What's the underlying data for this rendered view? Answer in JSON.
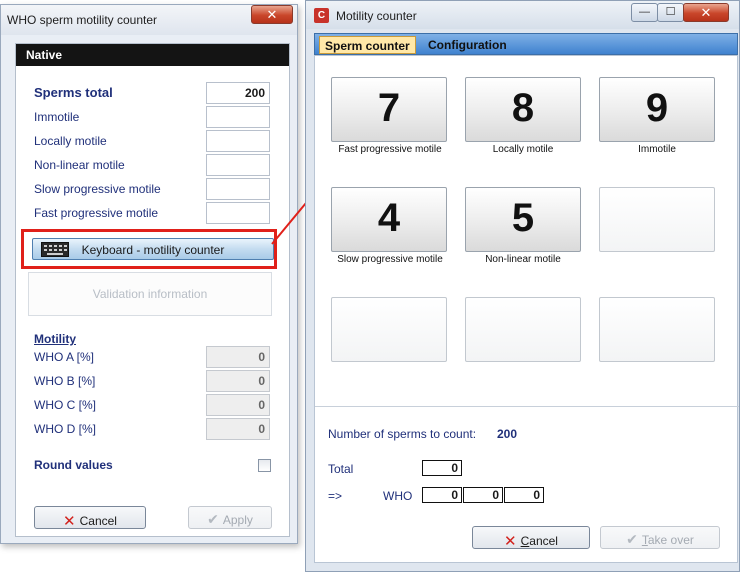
{
  "left_window": {
    "title": "WHO sperm motility counter",
    "close_glyph": "✕",
    "panel_title": "Native",
    "fields": [
      {
        "label": "Sperms total",
        "value": "200"
      },
      {
        "label": "Immotile",
        "value": ""
      },
      {
        "label": "Locally motile",
        "value": ""
      },
      {
        "label": "Non-linear motile",
        "value": ""
      },
      {
        "label": "Slow progressive motile",
        "value": ""
      },
      {
        "label": "Fast progressive motile",
        "value": ""
      }
    ],
    "keyboard_button_label": "Keyboard - motility counter",
    "keyboard_icon": "keyboard-icon",
    "validation_text": "Validation information",
    "motility_title": "Motility",
    "motility_fields": [
      {
        "label": "WHO A [%]",
        "value": "0"
      },
      {
        "label": "WHO B [%]",
        "value": "0"
      },
      {
        "label": "WHO C [%]",
        "value": "0"
      },
      {
        "label": "WHO D [%]",
        "value": "0"
      }
    ],
    "round_values_label": "Round values",
    "round_values_checked": false,
    "cancel_label": "Cancel",
    "apply_label": "Apply",
    "highlight_color": "#e0201a"
  },
  "right_window": {
    "title": "Motility counter",
    "app_icon_glyph": "C",
    "minimize_glyph": "—",
    "maximize_glyph": "☐",
    "close_glyph": "✕",
    "tabs": [
      {
        "label": "Sperm counter",
        "active": true
      },
      {
        "label": "Configuration",
        "active": false
      }
    ],
    "keys": [
      {
        "number": "7",
        "caption": "Fast progressive motile"
      },
      {
        "number": "8",
        "caption": "Locally motile"
      },
      {
        "number": "9",
        "caption": "Immotile"
      },
      {
        "number": "4",
        "caption": "Slow progressive motile"
      },
      {
        "number": "5",
        "caption": "Non-linear motile"
      },
      {
        "number": "",
        "caption": ""
      },
      {
        "number": "",
        "caption": ""
      },
      {
        "number": "",
        "caption": ""
      },
      {
        "number": "",
        "caption": ""
      }
    ],
    "count_label": "Number of sperms to count:",
    "count_value": "200",
    "total_label": "Total",
    "total_value": "0",
    "arrow_label": "=>",
    "who_label": "WHO",
    "who_values": [
      "0",
      "0",
      "0"
    ],
    "cancel_label_first": "C",
    "cancel_label_rest": "ancel",
    "takeover_label_first": "T",
    "takeover_label_rest": "ake over",
    "tab_active_color": "#ffe8a8",
    "tabstrip_color": "#3f82cf"
  }
}
